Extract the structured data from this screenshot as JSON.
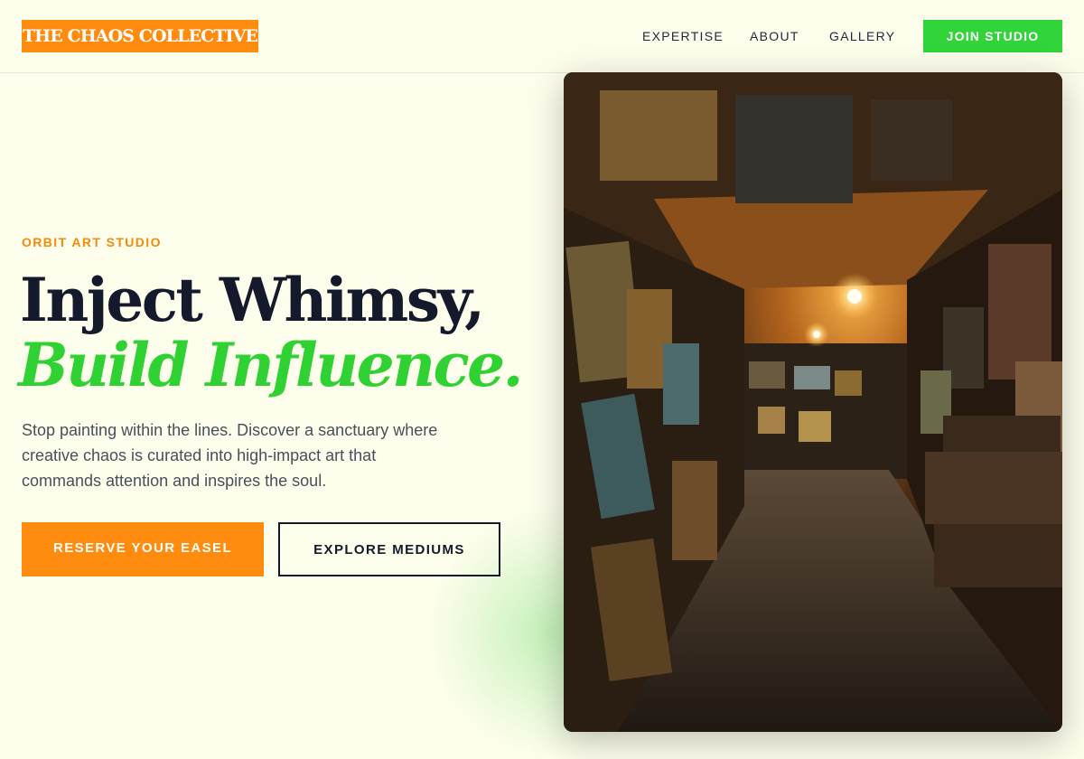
{
  "header": {
    "logo": "THE CHAOS COLLECTIVE",
    "nav": [
      {
        "label": "EXPERTISE"
      },
      {
        "label": "ABOUT"
      },
      {
        "label": "GALLERY"
      }
    ],
    "cta": "JOIN STUDIO"
  },
  "hero": {
    "eyebrow": "ORBIT ART STUDIO",
    "headline_line1": "Inject Whimsy,",
    "headline_line2": "Build Influence.",
    "body": "Stop painting within the lines. Discover a sanctuary where creative chaos is curated into high-impact art that commands attention and inspires the soul.",
    "primary_button": "RESERVE YOUR EASEL",
    "secondary_button": "EXPLORE MEDIUMS"
  },
  "colors": {
    "background": "#fefeed",
    "orange_accent": "#ff8c0f",
    "green_accent": "#31d43a",
    "dark_text": "#141a2c"
  }
}
